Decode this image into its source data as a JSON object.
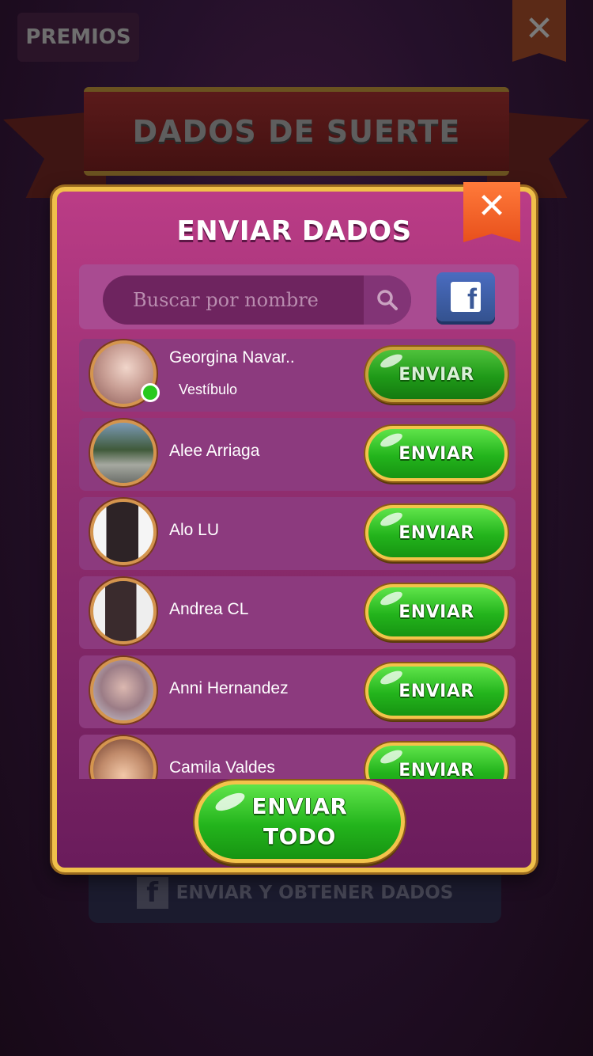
{
  "background": {
    "prizes_tab": "PREMIOS",
    "close_icon": "close-icon",
    "banner_title": "DADOS DE SUERTE",
    "facebook_button_label": "ENVIAR Y OBTENER DADOS",
    "facebook_icon_glyph": "f"
  },
  "modal": {
    "title": "ENVIAR DADOS",
    "close_glyph": "✕",
    "search": {
      "placeholder": "Buscar por nombre",
      "value": ""
    },
    "facebook_glyph": "f",
    "friends": [
      {
        "name": "Georgina Navar..",
        "status": "Vestíbulo",
        "online": true,
        "button": "ENVIAR"
      },
      {
        "name": "Alee Arriaga",
        "button": "ENVIAR"
      },
      {
        "name": "Alo LU",
        "button": "ENVIAR"
      },
      {
        "name": "Andrea CL",
        "button": "ENVIAR"
      },
      {
        "name": "Anni Hernandez",
        "button": "ENVIAR"
      },
      {
        "name": "Camila Valdes",
        "button": "ENVIAR"
      }
    ],
    "send_all_line1": "ENVIAR",
    "send_all_line2": "TODO"
  },
  "colors": {
    "modal_border": "#f0c04a",
    "modal_top": "#bb3c86",
    "modal_bottom": "#6a1c5c",
    "send_green": "#23b41c",
    "online_green": "#28c91e",
    "close_orange": "#e8501c"
  }
}
